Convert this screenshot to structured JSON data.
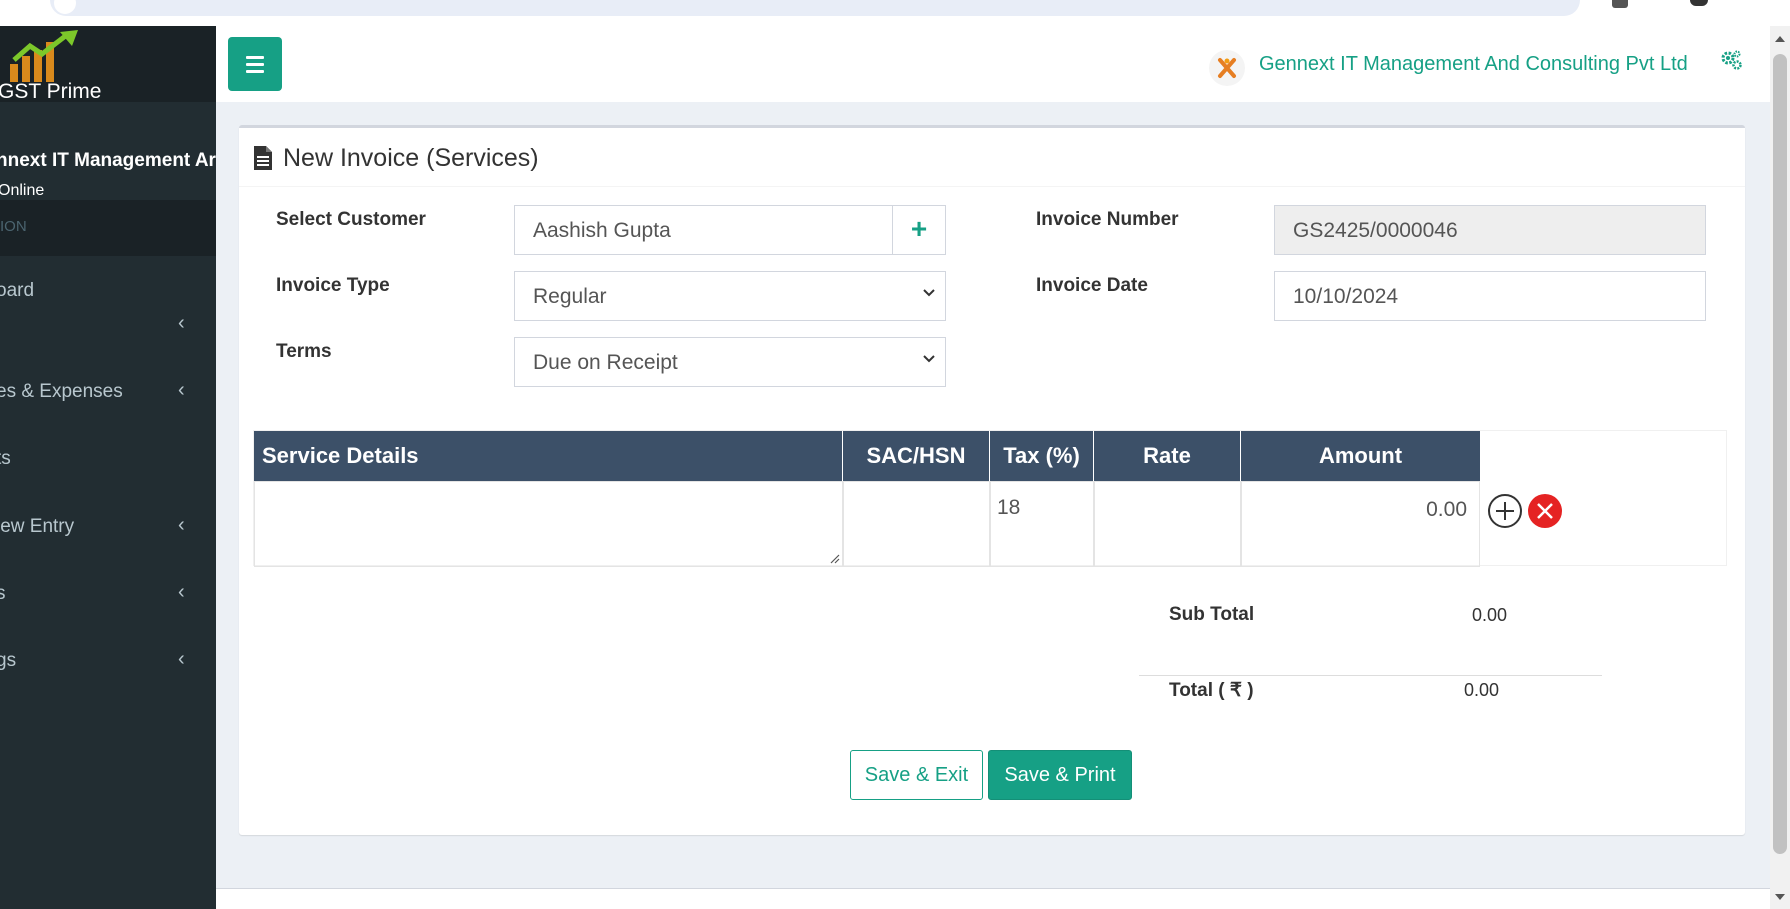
{
  "app": {
    "logo_text": "GST Prime"
  },
  "sidebar": {
    "user_name": "Gennext IT Management And Consulting Pvt Ltd",
    "user_name_visible": "nnext IT Management Ar",
    "status": "Online",
    "section_header": "ION",
    "items": [
      {
        "label": "oard",
        "has_chevron": false
      },
      {
        "label": "",
        "has_chevron": true
      },
      {
        "label": "es & Expenses",
        "has_chevron": true
      },
      {
        "label": "ts",
        "has_chevron": false
      },
      {
        "label": "iew Entry",
        "has_chevron": true
      },
      {
        "label": "s",
        "has_chevron": true
      },
      {
        "label": "gs",
        "has_chevron": true
      }
    ]
  },
  "header": {
    "company_name": "Gennext IT Management And Consulting Pvt Ltd",
    "menu_icon": "bars-icon",
    "settings_icon": "gears-icon"
  },
  "form": {
    "title": "New Invoice (Services)",
    "customer": {
      "label": "Select Customer",
      "value": "Aashish Gupta",
      "add_icon": "plus-icon"
    },
    "invoice_type": {
      "label": "Invoice Type",
      "value": "Regular"
    },
    "terms": {
      "label": "Terms",
      "value": "Due on Receipt"
    },
    "invoice_number": {
      "label": "Invoice Number",
      "value": "GS2425/0000046"
    },
    "invoice_date": {
      "label": "Invoice Date",
      "value": "10/10/2024"
    }
  },
  "table": {
    "headers": [
      "Service Details",
      "SAC/HSN",
      "Tax (%)",
      "Rate",
      "Amount"
    ],
    "rows": [
      {
        "service_details": "",
        "sac_hsn": "",
        "tax": "18",
        "rate": "",
        "amount": "0.00"
      }
    ]
  },
  "summary": {
    "subtotal_label": "Sub Total",
    "subtotal_value": "0.00",
    "total_label": "Total ( ₹ )",
    "total_value": "0.00"
  },
  "buttons": {
    "save_exit": "Save & Exit",
    "save_print": "Save & Print"
  },
  "colors": {
    "accent": "#16a085",
    "sidebar_bg": "#222d32",
    "table_header": "#3c5068",
    "danger": "#e52323"
  }
}
